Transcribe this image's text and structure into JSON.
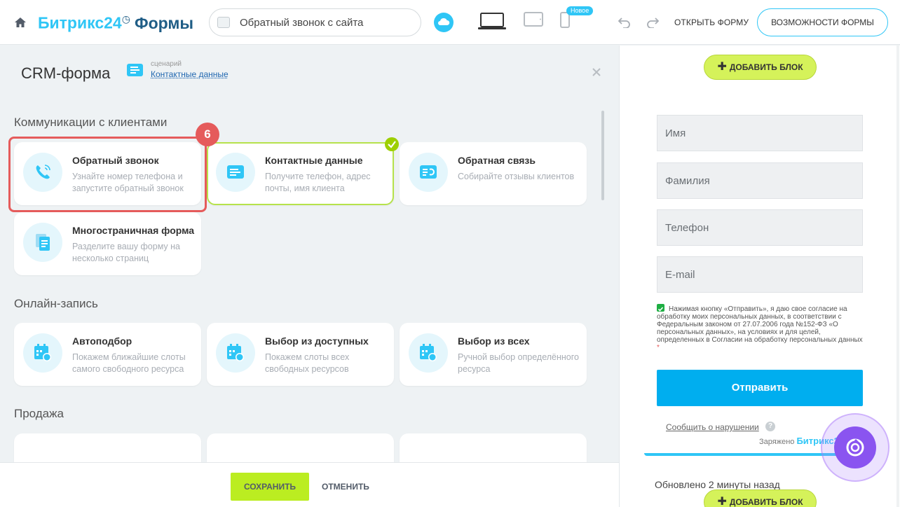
{
  "header": {
    "logo_main": "Битрикс24",
    "logo_sub": "Формы",
    "page_selector": "Обратный звонок с сайта",
    "new_badge": "Новое",
    "open_form": "ОТКРЫТЬ ФОРМУ",
    "form_capabilities": "ВОЗМОЖНОСТИ ФОРМЫ",
    "accent_color": "#2fc6f6"
  },
  "left": {
    "title": "CRM-форма",
    "scenario_caption": "сценарий",
    "scenario_link": "Контактные данные",
    "step_number": "6",
    "sections": [
      {
        "title": "Коммуникации с клиентами",
        "cards": [
          {
            "title": "Обратный звонок",
            "desc": "Узнайте номер телефона и запустите обратный звонок",
            "icon": "phone-icon"
          },
          {
            "title": "Контактные данные",
            "desc": "Получите телефон, адрес почты, имя клиента",
            "icon": "form-icon"
          },
          {
            "title": "Обратная связь",
            "desc": "Собирайте отзывы клиентов",
            "icon": "feedback-icon"
          },
          {
            "title": "Многостраничная форма",
            "desc": "Разделите вашу форму на несколько страниц",
            "icon": "pages-icon"
          }
        ]
      },
      {
        "title": "Онлайн-запись",
        "cards": [
          {
            "title": "Автоподбор",
            "desc": "Покажем ближайшие слоты самого свободного ресурса",
            "icon": "calendar-icon"
          },
          {
            "title": "Выбор из доступных",
            "desc": "Покажем слоты всех свободных ресурсов",
            "icon": "calendar-icon"
          },
          {
            "title": "Выбор из всех",
            "desc": "Ручной выбор определённого ресурса",
            "icon": "calendar-icon"
          }
        ]
      },
      {
        "title": "Продажа"
      }
    ],
    "save": "СОХРАНИТЬ",
    "cancel": "ОТМЕНИТЬ"
  },
  "right": {
    "add_block": "ДОБАВИТЬ БЛОК",
    "fields": [
      "Имя",
      "Фамилия",
      "Телефон",
      "E-mail"
    ],
    "consent": "Нажимая кнопку «Отправить», я даю свое согласие на обработку моих персональных данных, в соответствии с Федеральным законом от 27.07.2006 года №152-ФЗ «О персональных данных», на условиях и для целей, определенных в Согласии на обработку персональных данных",
    "consent_required": "*",
    "submit": "Отправить",
    "report": "Сообщить о нарушении",
    "help": "?",
    "powered_by": "Заряжено",
    "powered_brand": "Битрикс24",
    "updated": "Обновлено 2 минуты назад"
  }
}
